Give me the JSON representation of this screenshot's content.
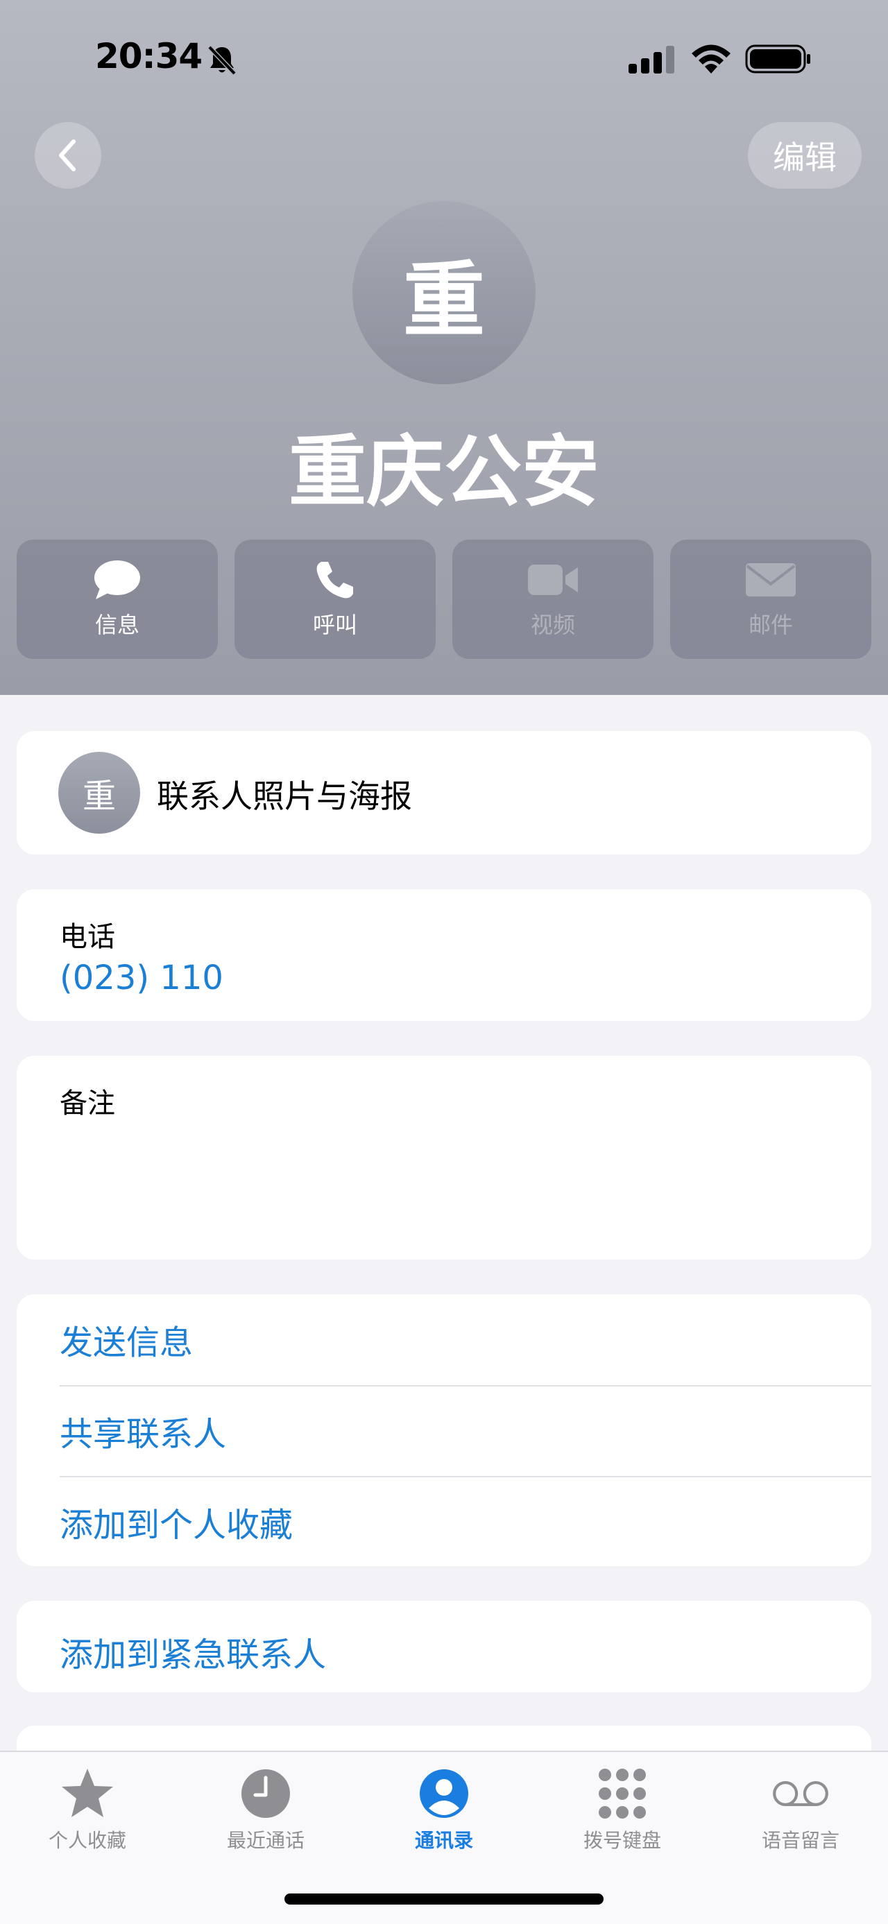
{
  "status_bar": {
    "time": "20:34",
    "icons": [
      "bell-slash-icon",
      "cellular-signal-icon",
      "wifi-icon",
      "battery-icon"
    ]
  },
  "nav": {
    "back_icon": "chevron-left-icon",
    "edit_label": "编辑"
  },
  "contact": {
    "avatar_initial": "重",
    "name": "重庆公安"
  },
  "quick_actions": [
    {
      "label": "信息",
      "icon": "message-bubble-icon",
      "enabled": true
    },
    {
      "label": "呼叫",
      "icon": "phone-icon",
      "enabled": true
    },
    {
      "label": "视频",
      "icon": "video-camera-icon",
      "enabled": false
    },
    {
      "label": "邮件",
      "icon": "envelope-icon",
      "enabled": false
    }
  ],
  "poster": {
    "avatar_initial": "重",
    "label": "联系人照片与海报"
  },
  "phone": {
    "label": "电话",
    "number": "(023) 110"
  },
  "notes": {
    "label": "备注"
  },
  "contact_actions": [
    "发送信息",
    "共享联系人",
    "添加到个人收藏"
  ],
  "emergency": {
    "label": "添加到紧急联系人"
  },
  "tabs": [
    {
      "label": "个人收藏",
      "icon": "star-icon",
      "active": false
    },
    {
      "label": "最近通话",
      "icon": "clock-icon",
      "active": false
    },
    {
      "label": "通讯录",
      "icon": "person-circle-icon",
      "active": true
    },
    {
      "label": "拨号键盘",
      "icon": "keypad-icon",
      "active": false
    },
    {
      "label": "语音留言",
      "icon": "voicemail-icon",
      "active": false
    }
  ],
  "colors": {
    "accent": "#1c7fd6",
    "tab_active": "#1a7ee0",
    "tab_inactive": "#8e8e93",
    "header_gradient_top": "#b7b9c2",
    "header_gradient_bottom": "#9a9ca8"
  }
}
